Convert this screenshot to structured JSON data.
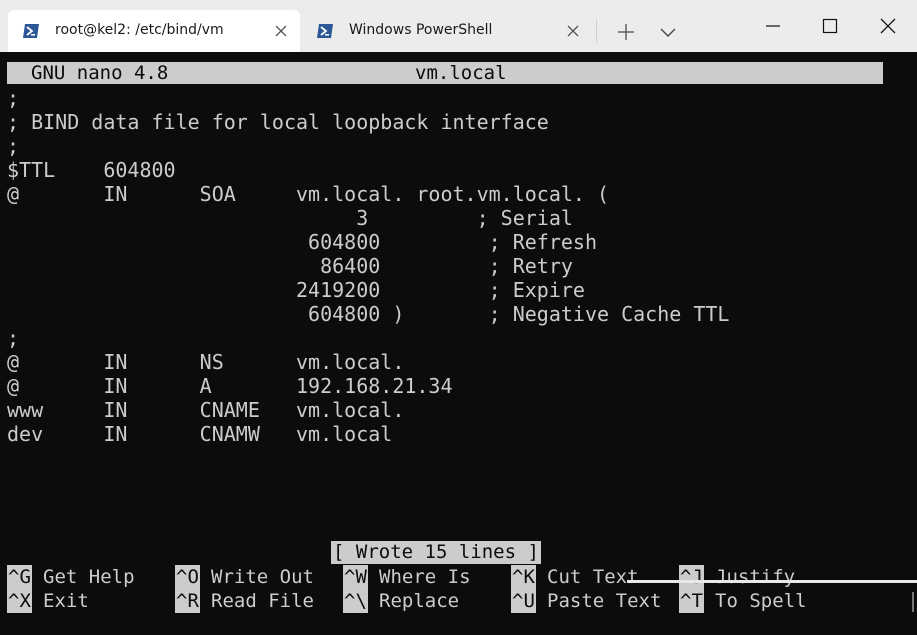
{
  "tabs": [
    {
      "title": "root@kel2: /etc/bind/vm",
      "icon": "powershell-icon",
      "active": true
    },
    {
      "title": "Windows PowerShell",
      "icon": "powershell-icon",
      "active": false
    }
  ],
  "window_controls": {
    "new_tab": "plus-icon",
    "dropdown": "chevron-down-icon",
    "minimize": "minimize-icon",
    "maximize": "maximize-icon",
    "close": "close-icon"
  },
  "nano": {
    "header_left": "GNU nano 4.8",
    "header_center": "vm.local",
    "lines": [
      ";",
      "; BIND data file for local loopback interface",
      ";",
      "$TTL    604800",
      "@       IN      SOA     vm.local. root.vm.local. (",
      "                             3         ; Serial",
      "                         604800         ; Refresh",
      "                          86400         ; Retry",
      "                        2419200         ; Expire",
      "                         604800 )       ; Negative Cache TTL",
      ";",
      "@       IN      NS      vm.local.",
      "@       IN      A       192.168.21.34",
      "www     IN      CNAME   vm.local.",
      "dev     IN      CNAMW   vm.local"
    ],
    "status_message": "[ Wrote 15 lines ]",
    "shortcuts": [
      [
        {
          "key": "^G",
          "label": "Get Help"
        },
        {
          "key": "^O",
          "label": "Write Out"
        },
        {
          "key": "^W",
          "label": "Where Is"
        },
        {
          "key": "^K",
          "label": "Cut Text"
        },
        {
          "key": "^J",
          "label": "Justify"
        }
      ],
      [
        {
          "key": "^X",
          "label": "Exit"
        },
        {
          "key": "^R",
          "label": "Read File"
        },
        {
          "key": "^\\",
          "label": "Replace"
        },
        {
          "key": "^U",
          "label": "Paste Text"
        },
        {
          "key": "^T",
          "label": "To Spell"
        }
      ]
    ]
  },
  "colors": {
    "terminal_bg": "#0c0c0c",
    "terminal_fg": "#cccccc",
    "titlebar_bg": "#ececec",
    "powershell_blue": "#2b5797"
  }
}
